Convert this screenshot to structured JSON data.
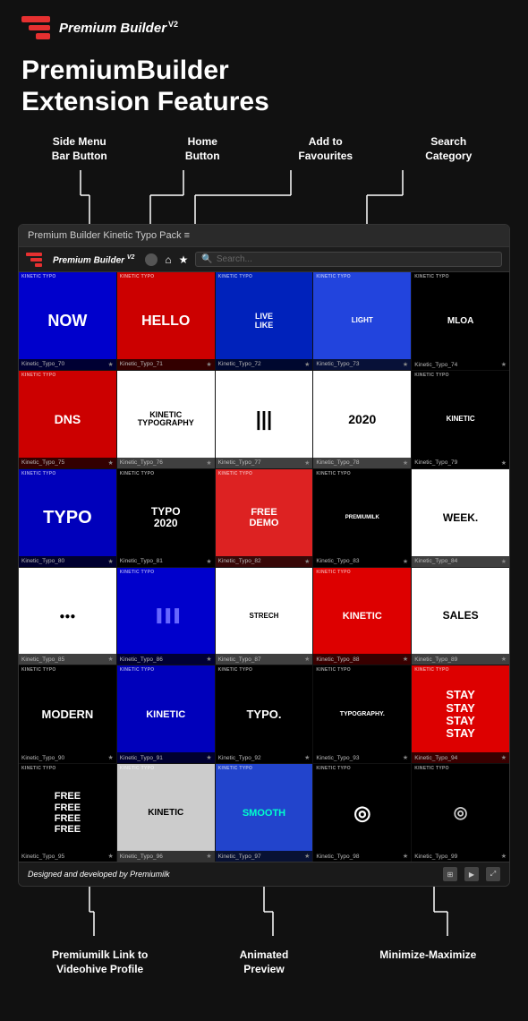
{
  "header": {
    "logo_alt": "Premium Builder Logo",
    "title": "Premium Builder",
    "version": "V2"
  },
  "main_heading": {
    "line1": "PremiumBuilder",
    "line2": "Extension Features"
  },
  "feature_labels": [
    {
      "id": "side-menu",
      "text": "Side Menu\nBar Button"
    },
    {
      "id": "home",
      "text": "Home\nButton"
    },
    {
      "id": "favourites",
      "text": "Add to\nFavourites"
    },
    {
      "id": "search",
      "text": "Search\nCategory"
    }
  ],
  "app_window": {
    "titlebar": "Premium Builder Kinetic Typo Pack  ≡",
    "toolbar_title": "Premium Builder",
    "toolbar_version": "V2",
    "search_placeholder": "Search...",
    "grid_items": [
      {
        "id": "70",
        "label": "Kinetic_Typo_70",
        "bg": "#0000cc",
        "text": "NOW",
        "textColor": "#ffffff",
        "fontSize": "18px"
      },
      {
        "id": "71",
        "label": "Kinetic_Typo_71",
        "bg": "#cc0000",
        "text": "HELLO",
        "textColor": "#ffffff",
        "fontSize": "16px"
      },
      {
        "id": "72",
        "label": "Kinetic_Typo_72",
        "bg": "#0022bb",
        "text": "LIVE\nLIKE",
        "textColor": "#ffffff",
        "fontSize": "9px"
      },
      {
        "id": "73",
        "label": "Kinetic_Typo_73",
        "bg": "#2244dd",
        "text": "LIGHT",
        "textColor": "#ffffff",
        "fontSize": "8px"
      },
      {
        "id": "74",
        "label": "Kinetic_Typo_74",
        "bg": "#000000",
        "text": "MLOA",
        "textColor": "#ffffff",
        "fontSize": "10px"
      },
      {
        "id": "75",
        "label": "Kinetic_Typo_75",
        "bg": "#cc0000",
        "text": "DNS",
        "textColor": "#ffffff",
        "fontSize": "14px"
      },
      {
        "id": "76",
        "label": "Kinetic_Typo_76",
        "bg": "#ffffff",
        "text": "KINETIC\nTYPOGRAPHY",
        "textColor": "#000000",
        "fontSize": "9px"
      },
      {
        "id": "77",
        "label": "Kinetic_Typo_77",
        "bg": "#ffffff",
        "text": "|||",
        "textColor": "#000000",
        "fontSize": "22px"
      },
      {
        "id": "78",
        "label": "Kinetic_Typo_78",
        "bg": "#ffffff",
        "text": "2020",
        "textColor": "#000000",
        "fontSize": "14px"
      },
      {
        "id": "79",
        "label": "Kinetic_Typo_79",
        "bg": "#000000",
        "text": "KINETIC",
        "textColor": "#ffffff",
        "fontSize": "8px"
      },
      {
        "id": "80",
        "label": "Kinetic_Typo_80",
        "bg": "#0000bb",
        "text": "TYPO",
        "textColor": "#ffffff",
        "fontSize": "20px"
      },
      {
        "id": "81",
        "label": "Kinetic_Typo_81",
        "bg": "#000000",
        "text": "TYPO\n2020",
        "textColor": "#ffffff",
        "fontSize": "12px"
      },
      {
        "id": "82",
        "label": "Kinetic_Typo_82",
        "bg": "#dd2222",
        "text": "FREE\nDEMO",
        "textColor": "#ffffff",
        "fontSize": "11px"
      },
      {
        "id": "83",
        "label": "Kinetic_Typo_83",
        "bg": "#000000",
        "text": "PREMIUMILK",
        "textColor": "#ffffff",
        "fontSize": "6px"
      },
      {
        "id": "84",
        "label": "Kinetic_Typo_84",
        "bg": "#ffffff",
        "text": "WEEK.",
        "textColor": "#000000",
        "fontSize": "12px"
      },
      {
        "id": "85",
        "label": "Kinetic_Typo_85",
        "bg": "#ffffff",
        "text": "●●●",
        "textColor": "#000000",
        "fontSize": "10px"
      },
      {
        "id": "86",
        "label": "Kinetic_Typo_86",
        "bg": "#0000cc",
        "text": "▐▐▐",
        "textColor": "#6666ff",
        "fontSize": "14px"
      },
      {
        "id": "87",
        "label": "Kinetic_Typo_87",
        "bg": "#ffffff",
        "text": "STRECH",
        "textColor": "#000000",
        "fontSize": "8px"
      },
      {
        "id": "88",
        "label": "Kinetic_Typo_88",
        "bg": "#dd0000",
        "text": "KINETIC",
        "textColor": "#ffffff",
        "fontSize": "11px"
      },
      {
        "id": "89",
        "label": "Kinetic_Typo_89",
        "bg": "#ffffff",
        "text": "SALES",
        "textColor": "#000000",
        "fontSize": "12px"
      },
      {
        "id": "90",
        "label": "Kinetic_Typo_90",
        "bg": "#000000",
        "text": "MODERN",
        "textColor": "#ffffff",
        "fontSize": "13px"
      },
      {
        "id": "91",
        "label": "Kinetic_Typo_91",
        "bg": "#0000bb",
        "text": "KINETIC",
        "textColor": "#ffffff",
        "fontSize": "11px"
      },
      {
        "id": "92",
        "label": "Kinetic_Typo_92",
        "bg": "#000000",
        "text": "Typo.",
        "textColor": "#ffffff",
        "fontSize": "13px"
      },
      {
        "id": "93",
        "label": "Kinetic_Typo_93",
        "bg": "#000000",
        "text": "Typography.",
        "textColor": "#ffffff",
        "fontSize": "7px"
      },
      {
        "id": "94",
        "label": "Kinetic_Typo_94",
        "bg": "#dd0000",
        "text": "STAY\nSTAY\nSTAY\nSTAY",
        "textColor": "#ffffff",
        "fontSize": "13px"
      },
      {
        "id": "95",
        "label": "Kinetic_Typo_95",
        "bg": "#000000",
        "text": "FREE\nFREE\nFREE\nFREE",
        "textColor": "#ffffff",
        "fontSize": "11px"
      },
      {
        "id": "96",
        "label": "Kinetic_Typo_96",
        "bg": "#cccccc",
        "text": "KINETIC",
        "textColor": "#000000",
        "fontSize": "10px"
      },
      {
        "id": "97",
        "label": "Kinetic_Typo_97",
        "bg": "#2244cc",
        "text": "SMOOTH",
        "textColor": "#00ffcc",
        "fontSize": "11px"
      },
      {
        "id": "98",
        "label": "Kinetic_Typo_98",
        "bg": "#000000",
        "text": "◎",
        "textColor": "#ffffff",
        "fontSize": "22px"
      },
      {
        "id": "99",
        "label": "Kinetic_Typo_99",
        "bg": "#000000",
        "text": "◎",
        "textColor": "#cccccc",
        "fontSize": "18px"
      }
    ]
  },
  "app_footer": {
    "designed_by": "Designed and developed by",
    "brand": "Premiumilk"
  },
  "bottom_labels": [
    {
      "id": "premiumilk-link",
      "text": "Premiumilk Link to\nVideohive Profile"
    },
    {
      "id": "animated-preview",
      "text": "Animated\nPreview"
    },
    {
      "id": "minimize-maximize",
      "text": "Minimize-Maximize"
    }
  ]
}
